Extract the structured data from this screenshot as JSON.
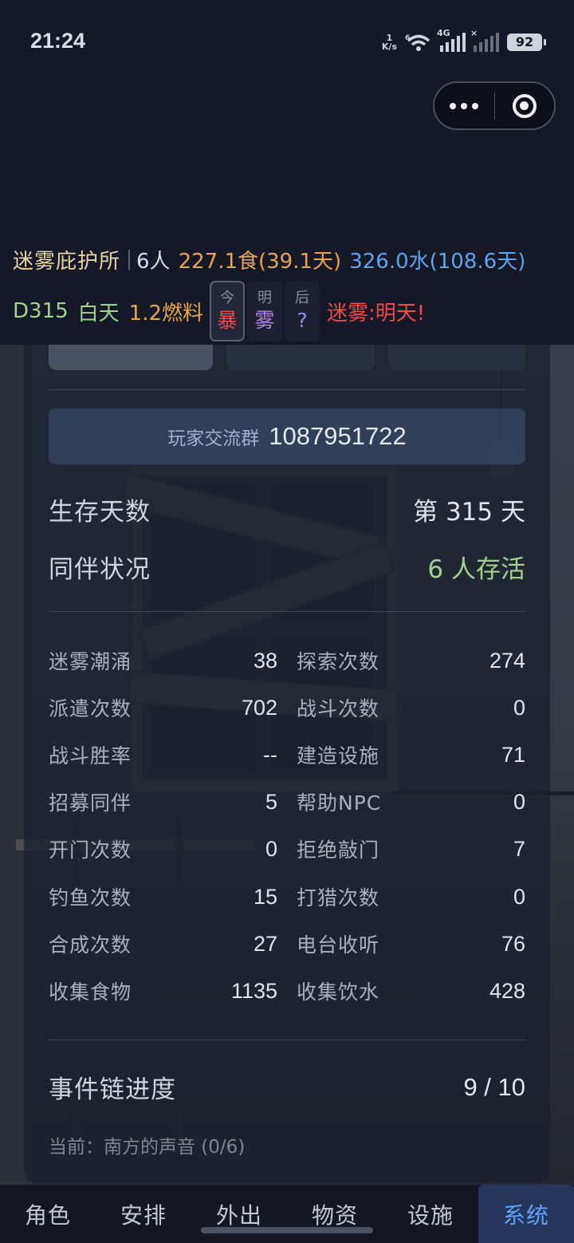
{
  "status_bar": {
    "time": "21:24",
    "net_speed_value": "1",
    "net_speed_unit": "K/s",
    "wifi_tag": "6",
    "cell_tag": "4G",
    "battery": "92",
    "icons": [
      "wifi-icon",
      "signal-icon",
      "signal-no-sim-icon",
      "battery-icon"
    ]
  },
  "capsule": {
    "more_icon": "more-dots-icon",
    "close_icon": "close-target-icon"
  },
  "header": {
    "shelter_name": "迷雾庇护所",
    "people": "6人",
    "food": "227.1食(39.1天)",
    "water": "326.0水(108.6天)",
    "day": "D315",
    "phase": "白天",
    "fuel": "1.2燃料",
    "forecast": [
      {
        "day": "今",
        "weather": "暴",
        "color": "#f04b4b"
      },
      {
        "day": "明",
        "weather": "雾",
        "color": "#b483e6"
      },
      {
        "day": "后",
        "weather": "?",
        "color": "#8c8fe6"
      }
    ],
    "alert": "迷雾:明天!"
  },
  "panel": {
    "group_label": "玩家交流群",
    "group_number": "1087951722",
    "survival_days_label": "生存天数",
    "survival_days_value": "第 315 天",
    "companions_label": "同伴状况",
    "companions_value": "6 人存活",
    "stats": [
      {
        "label": "迷雾潮涌",
        "value": "38"
      },
      {
        "label": "探索次数",
        "value": "274"
      },
      {
        "label": "派遣次数",
        "value": "702"
      },
      {
        "label": "战斗次数",
        "value": "0"
      },
      {
        "label": "战斗胜率",
        "value": "--"
      },
      {
        "label": "建造设施",
        "value": "71"
      },
      {
        "label": "招募同伴",
        "value": "5"
      },
      {
        "label": "帮助NPC",
        "value": "0"
      },
      {
        "label": "开门次数",
        "value": "0"
      },
      {
        "label": "拒绝敲门",
        "value": "7"
      },
      {
        "label": "钓鱼次数",
        "value": "15"
      },
      {
        "label": "打猎次数",
        "value": "0"
      },
      {
        "label": "合成次数",
        "value": "27"
      },
      {
        "label": "电台收听",
        "value": "76"
      },
      {
        "label": "收集食物",
        "value": "1135"
      },
      {
        "label": "收集饮水",
        "value": "428"
      }
    ],
    "chain_label": "事件链进度",
    "chain_value": "9 / 10",
    "current_event": "当前：南方的声音 (0/6)"
  },
  "nav": {
    "items": [
      "角色",
      "安排",
      "外出",
      "物资",
      "设施",
      "系统"
    ],
    "active": "系统"
  }
}
